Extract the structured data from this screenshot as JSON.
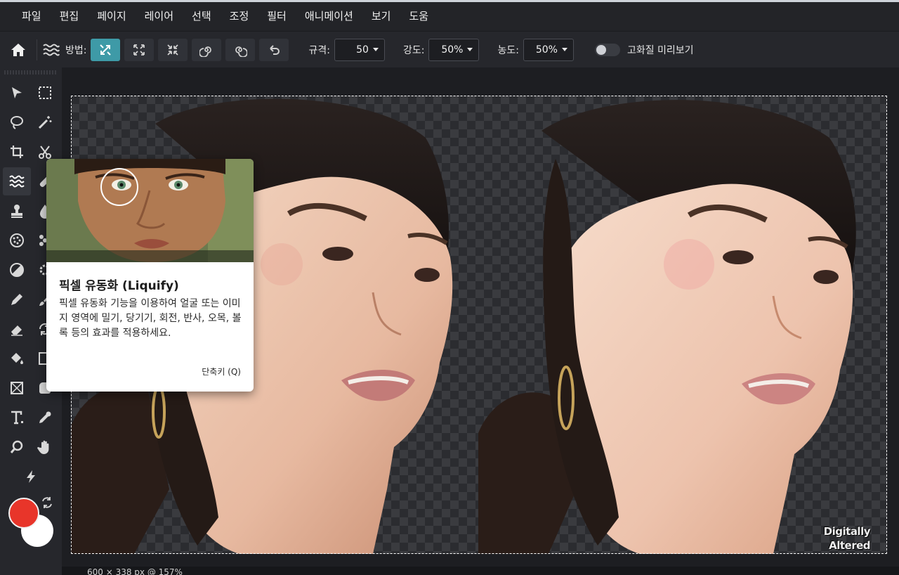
{
  "menu": [
    "파일",
    "편집",
    "페이지",
    "레이어",
    "선택",
    "조정",
    "필터",
    "애니메이션",
    "보기",
    "도움"
  ],
  "options": {
    "method_label": "방법:",
    "size_label": "규격:",
    "size_value": "50",
    "strength_label": "강도:",
    "strength_value": "50%",
    "density_label": "농도:",
    "density_value": "50%",
    "hq_preview_label": "고화질 미리보기",
    "hq_preview_on": false
  },
  "tooltip": {
    "title": "픽셀 유동화 (Liquify)",
    "description": "픽셀 유동화 기능을 이용하여 얼굴 또는 이미지 영역에 밀기, 당기기, 회전, 반사, 오목, 볼록 등의 효과를 적용하세요.",
    "shortcut": "단축키 (Q)"
  },
  "canvas": {
    "watermark_line1": "Digitally",
    "watermark_line2": "Altered"
  },
  "status": {
    "dimensions": "600 × 338 px @ 157%"
  },
  "colors": {
    "accent": "#3e9aa7",
    "foreground": "#e8352a",
    "background": "#ffffff"
  }
}
